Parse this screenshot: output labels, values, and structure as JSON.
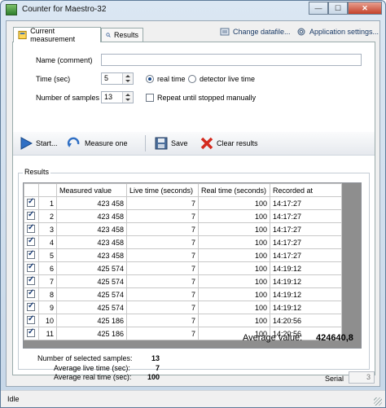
{
  "window": {
    "title": "Counter for Maestro-32"
  },
  "tabs": [
    {
      "label": "Current measurement",
      "active": true
    },
    {
      "label": "Results",
      "active": false
    }
  ],
  "links": {
    "change_datafile": "Change datafile...",
    "app_settings": "Application settings..."
  },
  "form": {
    "name_label": "Name (comment)",
    "name_value": "",
    "time_label": "Time (sec)",
    "time_value": "5",
    "real_time_label": "real time",
    "detector_live_time_label": "detector live time",
    "time_mode": "real time",
    "samples_label": "Number of samples",
    "samples_value": "13",
    "repeat_label": "Repeat until stopped manually",
    "repeat_checked": false
  },
  "toolbar": {
    "start_label": "Start...",
    "measure_one_label": "Measure one",
    "save_label": "Save",
    "clear_label": "Clear results"
  },
  "results": {
    "group_label": "Results",
    "columns": [
      "Measured value",
      "Live time (seconds)",
      "Real time (seconds)",
      "Recorded at"
    ],
    "rows": [
      {
        "n": "1",
        "checked": true,
        "measured": "423 458",
        "live": "7",
        "real": "100",
        "recorded": "14:17:27"
      },
      {
        "n": "2",
        "checked": true,
        "measured": "423 458",
        "live": "7",
        "real": "100",
        "recorded": "14:17:27"
      },
      {
        "n": "3",
        "checked": true,
        "measured": "423 458",
        "live": "7",
        "real": "100",
        "recorded": "14:17:27"
      },
      {
        "n": "4",
        "checked": true,
        "measured": "423 458",
        "live": "7",
        "real": "100",
        "recorded": "14:17:27"
      },
      {
        "n": "5",
        "checked": true,
        "measured": "423 458",
        "live": "7",
        "real": "100",
        "recorded": "14:17:27"
      },
      {
        "n": "6",
        "checked": true,
        "measured": "425 574",
        "live": "7",
        "real": "100",
        "recorded": "14:19:12"
      },
      {
        "n": "7",
        "checked": true,
        "measured": "425 574",
        "live": "7",
        "real": "100",
        "recorded": "14:19:12"
      },
      {
        "n": "8",
        "checked": true,
        "measured": "425 574",
        "live": "7",
        "real": "100",
        "recorded": "14:19:12"
      },
      {
        "n": "9",
        "checked": true,
        "measured": "425 574",
        "live": "7",
        "real": "100",
        "recorded": "14:19:12"
      },
      {
        "n": "10",
        "checked": true,
        "measured": "425 186",
        "live": "7",
        "real": "100",
        "recorded": "14:20:56"
      },
      {
        "n": "11",
        "checked": true,
        "measured": "425 186",
        "live": "7",
        "real": "100",
        "recorded": "14:20:56"
      }
    ]
  },
  "summary": {
    "selected_label": "Number of selected samples:",
    "selected_value": "13",
    "avg_live_label": "Average live time (sec):",
    "avg_live_value": "7",
    "avg_real_label": "Average real time (sec):",
    "avg_real_value": "100",
    "avg_value_label": "Average value:",
    "avg_value": "424640,8"
  },
  "serial": {
    "label": "Serial",
    "value": "3"
  },
  "status": {
    "text": "Idle"
  },
  "colors": {
    "accent": "#1a4a8a",
    "grid_bg": "#8e8e8e",
    "clear_red": "#d42a1e"
  },
  "icons": [
    "app-icon",
    "tab-settings-icon",
    "tab-results-icon",
    "datafile-icon",
    "gear-icon",
    "play-icon",
    "refresh-icon",
    "save-icon",
    "clear-icon"
  ]
}
